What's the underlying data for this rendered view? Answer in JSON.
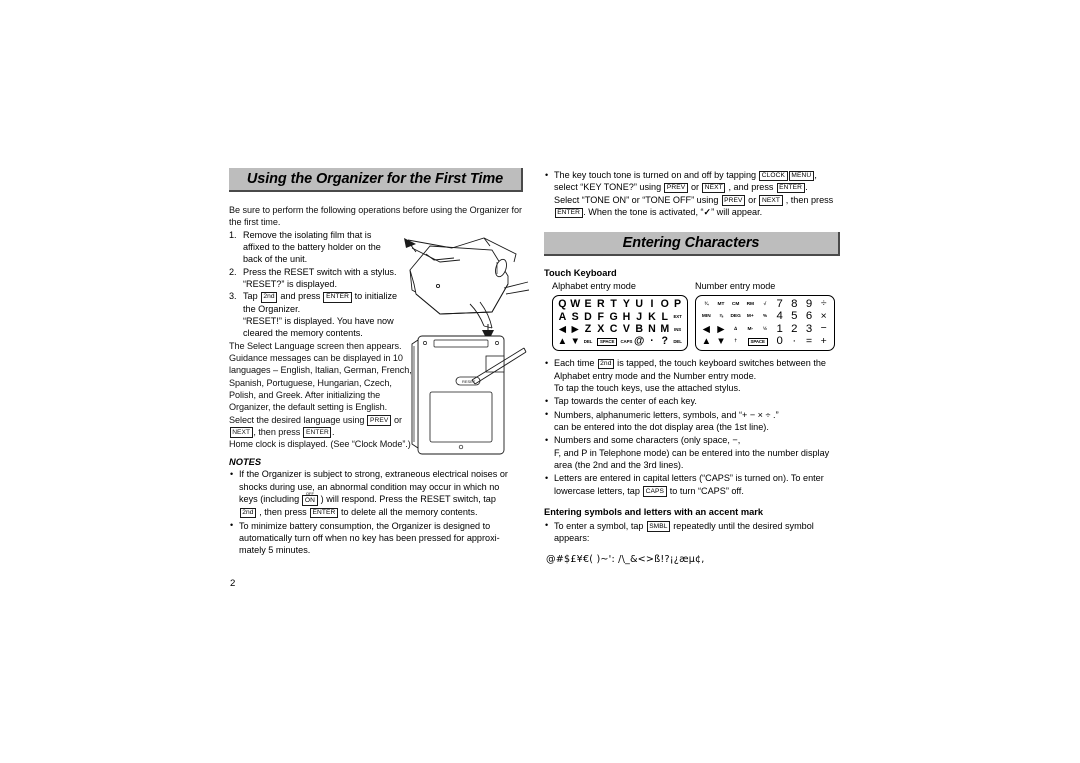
{
  "page": {
    "number": "2"
  },
  "left_column": {
    "section_title": "Using the Organizer for the First Time",
    "intro": "Be sure to perform the following operations before using the Organizer for the first time.",
    "steps": [
      {
        "marker": "1.",
        "lines": [
          "Remove the isolating film that is",
          "affixed to the battery holder on the",
          "back of the unit."
        ]
      },
      {
        "marker": "2.",
        "lines": [
          "Press the RESET switch with a stylus.",
          "“RESET?” is displayed."
        ]
      },
      {
        "marker": "3.",
        "step3_pre": "Tap ",
        "step3_key1": "2nd",
        "step3_mid": " and press ",
        "step3_key2": "ENTER",
        "step3_post": " to initialize",
        "lines": [
          "the Organizer.",
          "“RESET!” is displayed. You have now",
          "cleared the memory contents."
        ]
      }
    ],
    "language_para_lines": [
      "The Select Language screen then appears.",
      "Guidance messages can be displayed in 10",
      "languages – English, Italian, German, French,",
      "Spanish, Portuguese, Hungarian, Czech,",
      "Polish, and Greek. After initializing the",
      "Organizer, the default setting is English."
    ],
    "select_line_pre": "Select the desired language using ",
    "select_key_prev": "PREV",
    "select_line_mid": " or",
    "select_key_next": "NEXT",
    "select_line_mid2": ", then press ",
    "select_key_enter": "ENTER",
    "select_line_end": ".",
    "home_clock_line": "Home clock is displayed. (See “Clock Mode”.)",
    "notes_heading": "NOTES",
    "note1": {
      "line1": "If the Organizer is subject to strong, extraneous electrical noises or",
      "line2": "shocks during use, an abnormal condition may occur in which no",
      "line3_pre": "keys (including ",
      "line3_key": "ON",
      "line3_key_sup": "OFF",
      "line3_post": " ) will respond. Press the RESET switch, tap",
      "line4_key1": "2nd",
      "line4_mid": " , then press ",
      "line4_key2": "ENTER",
      "line4_post": " to delete all the memory contents."
    },
    "note2": {
      "line1": "To minimize battery consumption, the Organizer is designed to",
      "line2": "automatically turn off when no key has been pressed for approxi-",
      "line3": "mately 5 minutes."
    }
  },
  "right_column": {
    "key_tone_bullet": {
      "line1_pre": "The key touch tone is turned on and off by tapping ",
      "line1_key1": "CLOCK",
      "line1_key2": "MENU",
      "line1_post": ",",
      "line2_pre": "select “KEY TONE?” using ",
      "line2_key1": "PREV",
      "line2_mid": " or ",
      "line2_key2": "NEXT",
      "line2_mid2": " , and press ",
      "line2_key3": "ENTER",
      "line2_post": ".",
      "line3_pre": "Select “TONE ON” or “TONE OFF” using ",
      "line3_key1": "PREV",
      "line3_mid": " or ",
      "line3_key2": "NEXT",
      "line3_post": " , then press",
      "line4_key": "ENTER",
      "line4_post": ". When the tone is activated, “",
      "line4_check": "✓",
      "line4_end": "” will appear."
    },
    "section_title": "Entering Characters",
    "touch_keyboard_heading": "Touch Keyboard",
    "alpha_mode_label": "Alphabet entry mode",
    "number_mode_label": "Number entry mode",
    "keyboards": {
      "alphabet": {
        "row1": [
          "Q",
          "W",
          "E",
          "R",
          "T",
          "Y",
          "U",
          "I",
          "O",
          "P"
        ],
        "row2": [
          "A",
          "S",
          "D",
          "F",
          "G",
          "H",
          "J",
          "K",
          "L",
          "EXT"
        ],
        "row3": [
          "◀",
          "▶",
          "Z",
          "X",
          "C",
          "V",
          "B",
          "N",
          "M",
          "INS"
        ],
        "row4": [
          "▲",
          "▼",
          "DEL",
          "SPACE",
          "CAPS",
          "@",
          "·",
          "?",
          "DEL"
        ]
      },
      "number": {
        "row1": [
          "¾",
          "MT",
          "CM",
          "RM",
          "√",
          "7",
          "8",
          "9",
          "÷"
        ],
        "row2": [
          "MIN",
          "⅞",
          "DEG",
          "M+",
          "%",
          "4",
          "5",
          "6",
          "×"
        ],
        "row3": [
          "◀",
          "▶",
          "∆",
          "M-",
          "½",
          "1",
          "2",
          "3",
          "−"
        ],
        "row4": [
          "▲",
          "▼",
          "†",
          "SPACE",
          "0",
          "·",
          "=",
          "+"
        ]
      }
    },
    "bullets": [
      {
        "line1_pre": "Each time ",
        "line1_key": "2nd",
        "line1_post": " is tapped, the touch keyboard switches between the",
        "line2": "Alphabet entry mode and the Number entry mode.",
        "line3": "To tap the touch keys, use the attached stylus."
      },
      {
        "line1": "Tap towards the center of each key."
      },
      {
        "line1": "Numbers, alphanumeric letters, symbols, and “+ − × ÷ .”",
        "line2": "can be entered into the dot display area (the 1st line)."
      },
      {
        "line1": "Numbers and some characters (only space, −,",
        "line2": "F, and P in Telephone mode) can be entered into the number display",
        "line3": "area (the 2nd and the 3rd lines)."
      },
      {
        "line1": "Letters are entered in capital letters (“CAPS” is turned on). To enter",
        "line2_pre": "lowercase letters, tap ",
        "line2_key": "CAPS",
        "line2_post": " to turn “CAPS” off."
      }
    ],
    "accent_heading": "Entering symbols and letters with an accent mark",
    "accent_bullet": {
      "line1_pre": "To enter a symbol, tap ",
      "line1_key": "SMBL",
      "line1_post": " repeatedly until the desired symbol",
      "line2": "appears:"
    },
    "symbol_string": "@#$£¥€( )~': /\\_&<>ß!?¡¿æµ¢,"
  },
  "colors": {
    "header_bar": "#bdbdbd",
    "header_shadow": "#4a4a4a",
    "text": "#000000",
    "background": "#ffffff"
  }
}
